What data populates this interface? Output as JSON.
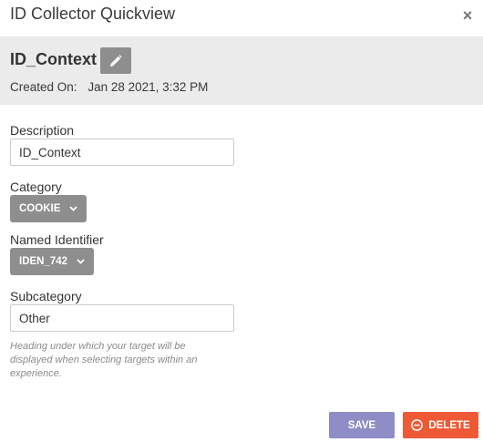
{
  "dialog": {
    "title": "ID Collector Quickview",
    "close_icon": "close-icon"
  },
  "header": {
    "name": "ID_Context",
    "edit_icon": "pencil-icon",
    "created_label": "Created On:",
    "created_value": "Jan 28 2021, 3:32 PM"
  },
  "form": {
    "description": {
      "label": "Description",
      "value": "ID_Context"
    },
    "category": {
      "label": "Category",
      "value": "COOKIE",
      "icon": "chevron-down-icon"
    },
    "named_identifier": {
      "label": "Named Identifier",
      "value": "IDEN_742",
      "icon": "chevron-down-icon"
    },
    "subcategory": {
      "label": "Subcategory",
      "value": "Other",
      "hint": "Heading under which your target will be displayed when selecting targets within an experience."
    }
  },
  "footer": {
    "save_label": "SAVE",
    "delete_label": "DELETE",
    "delete_icon": "minus-circle-icon"
  },
  "colors": {
    "header_bg": "#ebebeb",
    "gray_button": "#8e8e8e",
    "save_button": "#8e8dc5",
    "delete_button": "#ee5a36"
  }
}
